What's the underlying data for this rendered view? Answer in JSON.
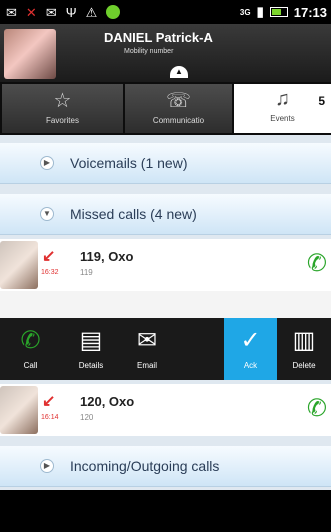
{
  "status_bar": {
    "time": "17:13",
    "left_icons": [
      "email-icon",
      "missed-call-icon",
      "mail-icon",
      "usb-icon",
      "warning-icon",
      "app-icon"
    ],
    "right_icons": [
      "network-icon",
      "signal-icon",
      "battery-icon"
    ]
  },
  "header": {
    "name": "DANIEL Patrick-A",
    "subtitle": "Mobility number"
  },
  "tabs": [
    {
      "label": "Favorites",
      "icon": "star-icon"
    },
    {
      "label": "Communicatio",
      "icon": "phone-icon"
    },
    {
      "label": "Events",
      "icon": "events-icon",
      "count": "5"
    }
  ],
  "sections": {
    "voicemails": "Voicemails (1 new)",
    "missed": "Missed calls (4 new)",
    "incoming": "Incoming/Outgoing calls"
  },
  "calls": [
    {
      "title": "119, Oxo",
      "number": "119",
      "time": "16:32"
    },
    {
      "title": "120, Oxo",
      "number": "120",
      "time": "16:14"
    }
  ],
  "actions": [
    {
      "label": "Call",
      "icon": "phone-icon"
    },
    {
      "label": "Details",
      "icon": "details-icon"
    },
    {
      "label": "Email",
      "icon": "email-icon"
    },
    {
      "label": "Ack",
      "icon": "check-icon",
      "active": true
    },
    {
      "label": "Delete",
      "icon": "trash-icon"
    }
  ]
}
